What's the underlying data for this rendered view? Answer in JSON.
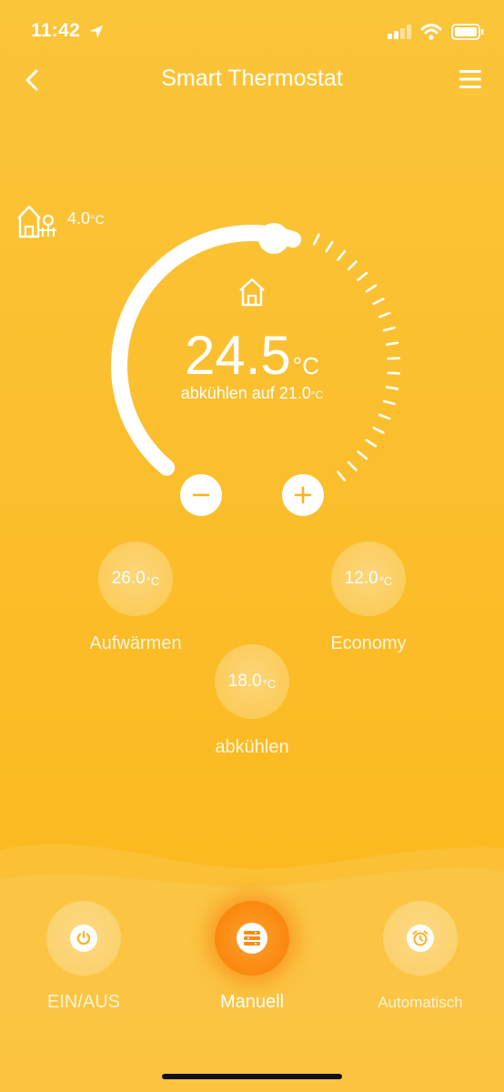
{
  "status_bar": {
    "time": "11:42"
  },
  "header": {
    "title": "Smart Thermostat"
  },
  "outdoor": {
    "temp": "4.0",
    "unit": "°C"
  },
  "dial": {
    "current_temp": "24.5",
    "unit": "°C",
    "target_text": "abkühlen auf 21.0",
    "target_unit": "°C"
  },
  "presets": [
    {
      "value": "26.0",
      "unit": "°C",
      "label": "Aufwärmen"
    },
    {
      "value": "12.0",
      "unit": "°C",
      "label": "Economy"
    },
    {
      "value": "18.0",
      "unit": "°C",
      "label": "abkühlen"
    }
  ],
  "modes": [
    {
      "label": "EIN/AUS",
      "icon": "power-icon"
    },
    {
      "label": "Manuell",
      "icon": "manual-list-icon",
      "active": true
    },
    {
      "label": "Automatisch",
      "icon": "alarm-clock-icon"
    }
  ],
  "colors": {
    "background": "#fbbe2c",
    "active_mode": "#fb8b12",
    "foreground": "#ffffff"
  }
}
